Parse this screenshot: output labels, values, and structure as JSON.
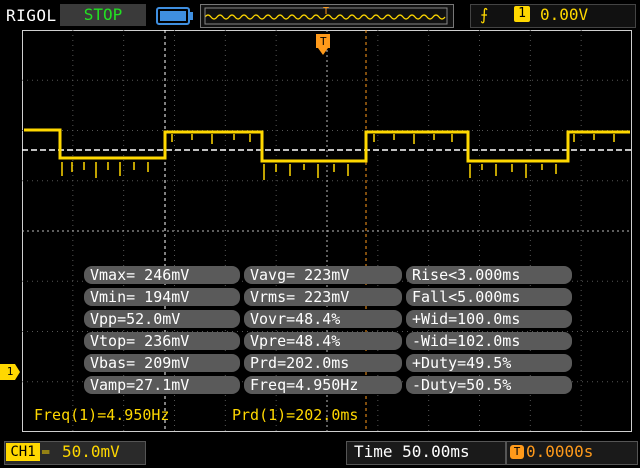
{
  "header": {
    "brand": "RIGOL",
    "status": "STOP",
    "battery_icon": "battery-icon",
    "trigger": {
      "edge_icon": "rising-edge-icon",
      "source": "1",
      "level": "0.00V"
    },
    "trigger_position_marker": "T"
  },
  "channel": {
    "marker": "1",
    "color": "#ffd800"
  },
  "measurements": {
    "rows": [
      [
        "Vmax= 246mV",
        "Vavg= 223mV",
        "Rise<3.000ms"
      ],
      [
        "Vmin= 194mV",
        "Vrms= 223mV",
        "Fall<5.000ms"
      ],
      [
        "Vpp=52.0mV",
        "Vovr=48.4%",
        "+Wid=100.0ms"
      ],
      [
        "Vtop= 236mV",
        "Vpre=48.4%",
        "-Wid=102.0ms"
      ],
      [
        "Vbas= 209mV",
        "Prd=202.0ms",
        "+Duty=49.5%"
      ],
      [
        "Vamp=27.1mV",
        "Freq=4.950Hz",
        "-Duty=50.5%"
      ]
    ]
  },
  "readouts": {
    "freq": "Freq(1)=4.950Hz",
    "prd": "Prd(1)=202.0ms"
  },
  "footer": {
    "ch_label": "CH1",
    "coupling_icon": "dc-coupling-icon",
    "ch_scale": "50.0mV",
    "timebase": "Time 50.00ms",
    "offset_icon": "trigger-offset-icon",
    "offset": "0.0000s"
  }
}
